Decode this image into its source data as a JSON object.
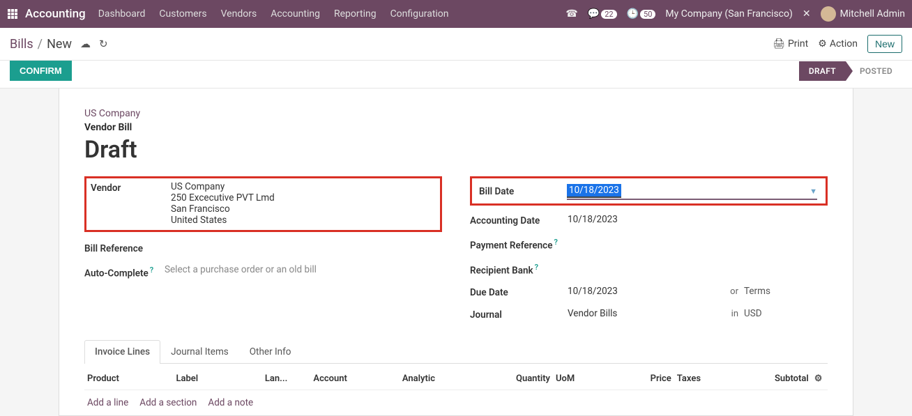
{
  "topbar": {
    "brand": "Accounting",
    "nav": [
      "Dashboard",
      "Customers",
      "Vendors",
      "Accounting",
      "Reporting",
      "Configuration"
    ],
    "msg_count": "22",
    "clock_count": "50",
    "company": "My Company (San Francisco)",
    "user": "Mitchell Admin"
  },
  "breadcrumb": {
    "parent": "Bills",
    "current": "New"
  },
  "actions": {
    "print": "Print",
    "action": "Action",
    "new": "New",
    "confirm": "CONFIRM"
  },
  "stages": {
    "draft": "DRAFT",
    "posted": "POSTED"
  },
  "form": {
    "company_link": "US Company",
    "doc_type": "Vendor Bill",
    "title": "Draft",
    "labels": {
      "vendor": "Vendor",
      "bill_reference": "Bill Reference",
      "auto_complete": "Auto-Complete",
      "bill_date": "Bill Date",
      "accounting_date": "Accounting Date",
      "payment_reference": "Payment Reference",
      "recipient_bank": "Recipient Bank",
      "due_date": "Due Date",
      "journal": "Journal",
      "or": "or",
      "in": "in"
    },
    "vendor": {
      "name": "US Company",
      "line1": "250 Excecutive PVT Lmd",
      "line2": "San Francisco",
      "line3": "United States"
    },
    "auto_complete_placeholder": "Select a purchase order or an old bill",
    "bill_date": "10/18/2023",
    "accounting_date": "10/18/2023",
    "due_date": "10/18/2023",
    "terms": "Terms",
    "journal": "Vendor Bills",
    "currency": "USD"
  },
  "tabs": [
    "Invoice Lines",
    "Journal Items",
    "Other Info"
  ],
  "columns": {
    "product": "Product",
    "label": "Label",
    "lan": "Lan...",
    "account": "Account",
    "analytic": "Analytic",
    "quantity": "Quantity",
    "uom": "UoM",
    "price": "Price",
    "taxes": "Taxes",
    "subtotal": "Subtotal"
  },
  "add_links": {
    "line": "Add a line",
    "section": "Add a section",
    "note": "Add a note"
  }
}
